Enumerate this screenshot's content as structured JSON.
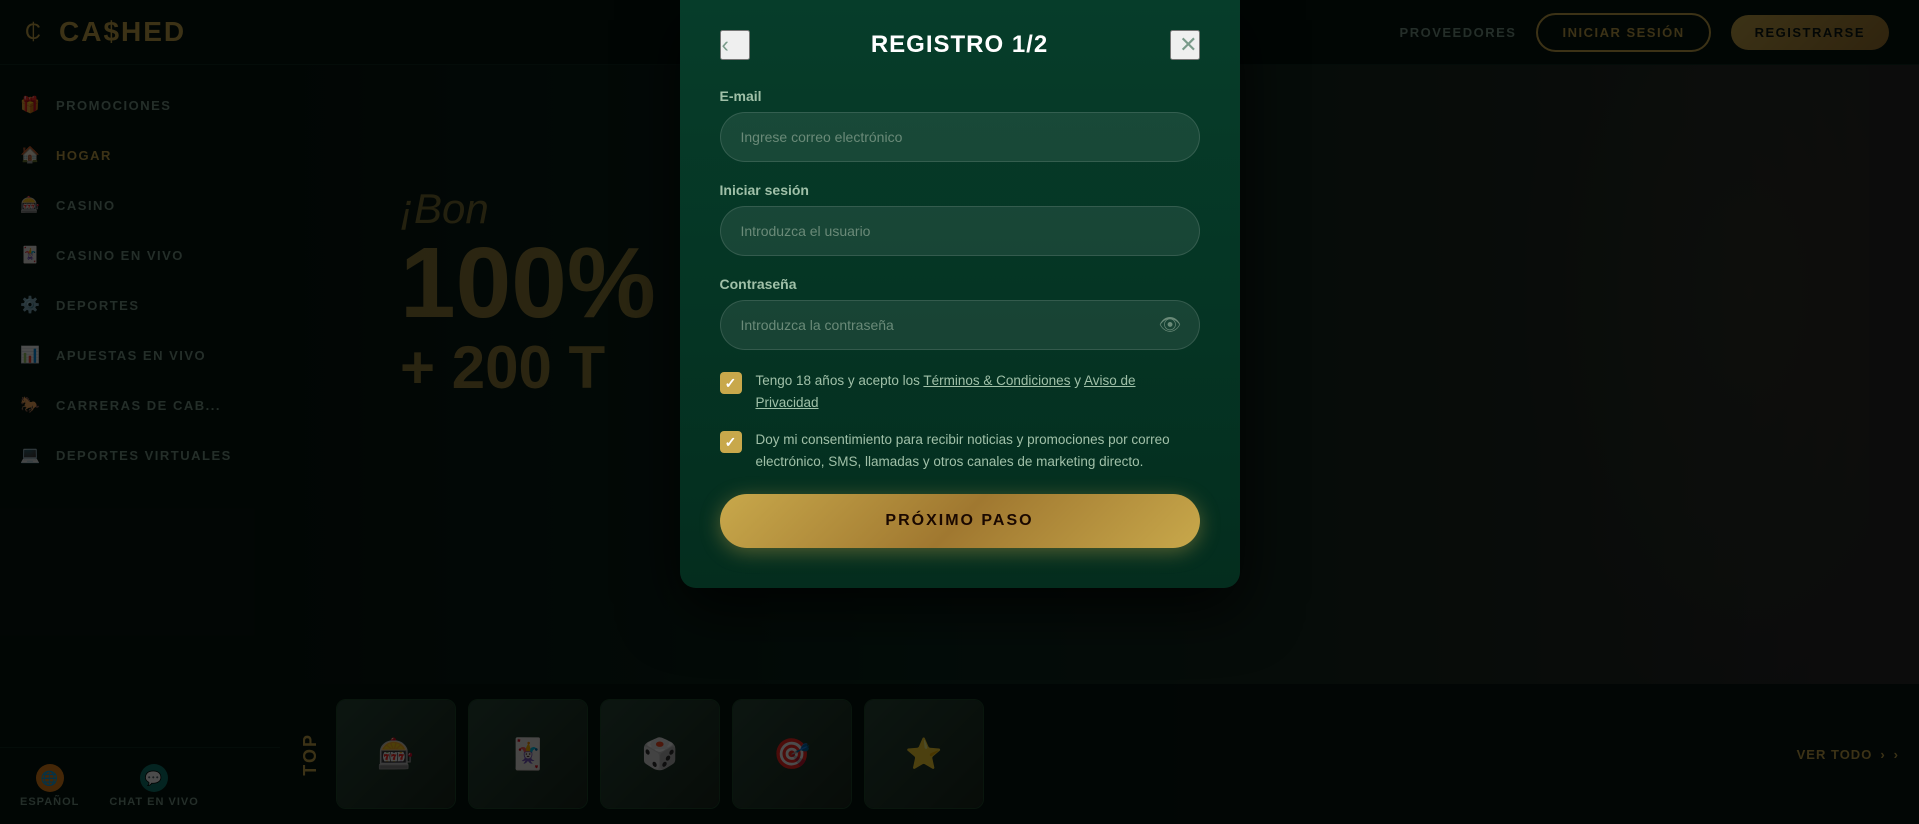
{
  "logo": {
    "icon": "₵",
    "text": "CA$HED"
  },
  "sidebar": {
    "items": [
      {
        "id": "promociones",
        "label": "PROMOCIONES",
        "icon": "🎁"
      },
      {
        "id": "hogar",
        "label": "HOGAR",
        "icon": "🏠"
      },
      {
        "id": "casino",
        "label": "CASINO",
        "icon": "🎰"
      },
      {
        "id": "casino-en-vivo",
        "label": "CASINO EN VIVO",
        "icon": "🃏"
      },
      {
        "id": "deportes",
        "label": "DEPORTES",
        "icon": "⚙️"
      },
      {
        "id": "apuestas-en-vivo",
        "label": "APUESTAS EN VIVO",
        "icon": "📊"
      },
      {
        "id": "carreras",
        "label": "CARRERAS DE CAB...",
        "icon": "🐎"
      },
      {
        "id": "deportes-virtuales",
        "label": "DEPORTES VIRTUALES",
        "icon": "💻"
      }
    ],
    "bottom": [
      {
        "id": "espanol",
        "label": "ESPAÑOL",
        "icon": "🌐",
        "color": "orange"
      },
      {
        "id": "chat",
        "label": "CHAT EN VIVO",
        "icon": "💬",
        "color": "teal"
      }
    ]
  },
  "header": {
    "nav_items": [
      {
        "id": "proveedores",
        "label": "Proveedores"
      }
    ],
    "btn_login": "INICIAR SESIÓN",
    "btn_register": "REGISTRARSE"
  },
  "hero": {
    "boni_text": "¡Bon",
    "percent": "100%",
    "tiradas": "+ 200 T",
    "top_label": "TOP",
    "ver_todo": "VER TODO"
  },
  "modal": {
    "title": "REGISTRO 1",
    "title_step": "/2",
    "back_icon": "‹",
    "close_icon": "✕",
    "fields": {
      "email": {
        "label": "E-mail",
        "placeholder": "Ingrese correo electrónico",
        "value": ""
      },
      "username": {
        "label": "Iniciar sesión",
        "placeholder": "Introduzca el usuario",
        "value": ""
      },
      "password": {
        "label": "Contraseña",
        "placeholder": "Introduzca la contraseña",
        "value": ""
      }
    },
    "checkbox1_text": "Tengo 18 años y acepto los ",
    "checkbox1_link1": "Términos & Condiciones",
    "checkbox1_and": " y ",
    "checkbox1_link2": "Aviso de Privacidad",
    "checkbox2_text": "Doy mi consentimiento para recibir noticias y promociones por correo electrónico, SMS, llamadas y otros canales de marketing directo.",
    "submit_label": "PRÓXIMO PASO"
  }
}
